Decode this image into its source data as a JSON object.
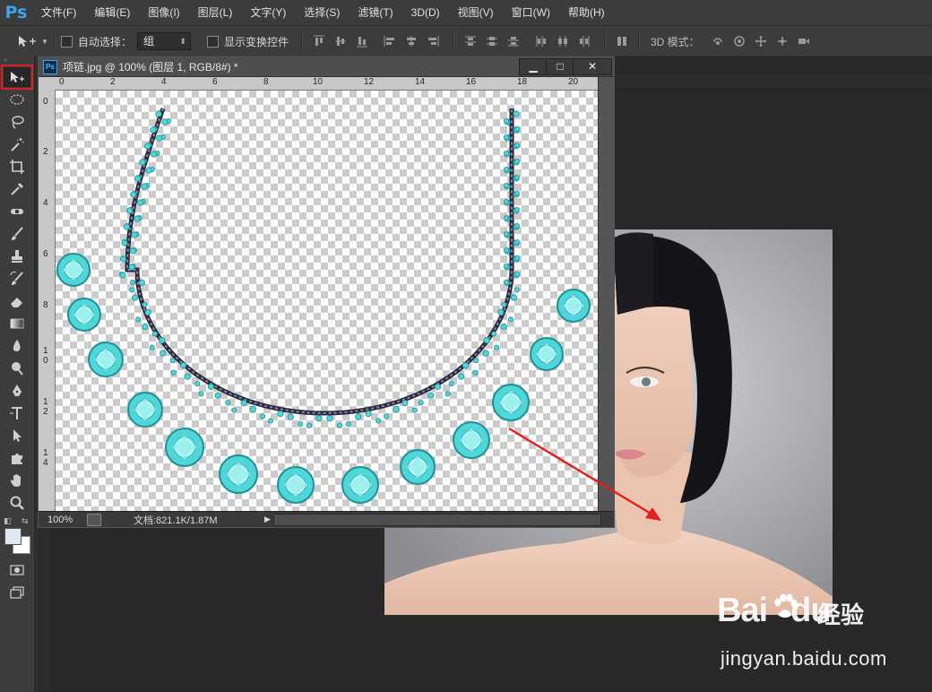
{
  "app": {
    "logo": "Ps"
  },
  "menubar": {
    "items": [
      "文件(F)",
      "编辑(E)",
      "图像(I)",
      "图层(L)",
      "文字(Y)",
      "选择(S)",
      "滤镜(T)",
      "3D(D)",
      "视图(V)",
      "窗口(W)",
      "帮助(H)"
    ]
  },
  "options": {
    "auto_select_label": "自动选择：",
    "auto_select_value": "组",
    "show_transform_label": "显示变换控件",
    "mode_3d_label": "3D 模式："
  },
  "toolbar": {
    "tools": [
      "move-tool",
      "elliptical-marquee-tool",
      "lasso-tool",
      "magic-wand-tool",
      "crop-tool",
      "eyedropper-tool",
      "healing-brush-tool",
      "brush-tool",
      "clone-stamp-tool",
      "history-brush-tool",
      "eraser-tool",
      "gradient-tool",
      "blur-tool",
      "dodge-tool",
      "pen-tool",
      "type-tool",
      "path-selection-tool",
      "custom-shape-tool",
      "hand-tool",
      "zoom-tool"
    ],
    "active_tool": "move-tool"
  },
  "document": {
    "title": "项链.jpg @ 100% (图层 1, RGB/8#) *",
    "ruler_top": [
      "0",
      "2",
      "4",
      "6",
      "8",
      "10",
      "12",
      "14",
      "16",
      "18",
      "20"
    ],
    "ruler_left": [
      "0",
      "2",
      "4",
      "6",
      "8",
      "1\n0",
      "1\n2",
      "1\n4"
    ],
    "zoom": "100%",
    "doc_size": "文档:821.1K/1.87M",
    "win_minimize": "▁",
    "win_maximize": "□",
    "win_close": "✕"
  },
  "colors": {
    "accent": "#3ba3f0",
    "highlight": "#e02020",
    "gem": "#4fd6d8",
    "gem_dark": "#1f8f95"
  },
  "watermark": {
    "brand": "Bai",
    "brand2": "du",
    "jingyan": "经验",
    "url": "jingyan.baidu.com"
  }
}
